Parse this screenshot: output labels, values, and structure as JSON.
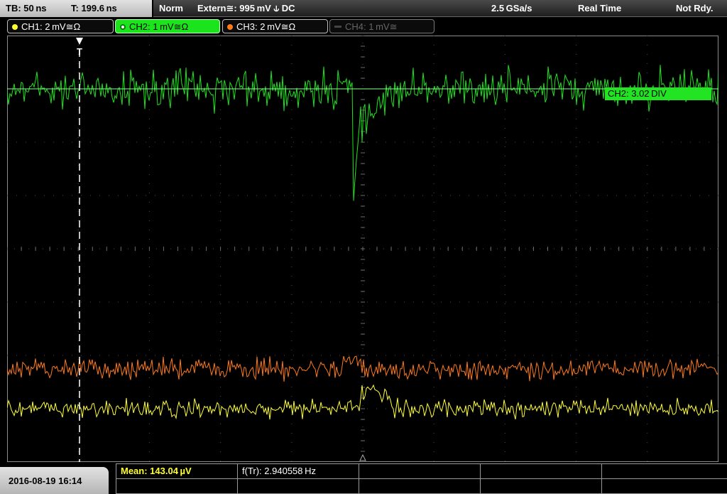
{
  "header": {
    "timebase": "TB: 50 ns",
    "trigger_time": "T: 199.6 ns",
    "trigger_mode": "Norm",
    "trigger_source": "Extern≅: 995 mV ⫝ DC",
    "sample_rate": "2.5 GSa/s",
    "acquisition_mode": "Real Time",
    "status": "Not Rdy."
  },
  "channels": [
    {
      "id": "ch1",
      "label": "CH1: 2 mV≅Ω",
      "color": "#ffff33",
      "active": true
    },
    {
      "id": "ch2",
      "label": "CH2: 1 mV≅Ω",
      "color": "#1ce41c",
      "active": true
    },
    {
      "id": "ch3",
      "label": "CH3: 2 mV≅Ω",
      "color": "#ff7a1a",
      "active": true
    },
    {
      "id": "ch4",
      "label": "CH4: 1 mV≅",
      "color": "#666666",
      "active": false
    }
  ],
  "ch2_offset_label": "CH2: 3.02 DIV",
  "footer": {
    "datetime": "2016-08-19 16:14",
    "mean": "Mean: 143.04 µV",
    "frequency": "f(Tr): 2.940558 Hz"
  },
  "chart_data": {
    "type": "line",
    "grid": true,
    "divisions": {
      "x": 10,
      "y": 8
    },
    "series": [
      {
        "name": "CH2",
        "color": "#1ce41c",
        "baseline_div": 3.0,
        "feature": "negative spike at center, approx -2.3 div"
      },
      {
        "name": "CH3",
        "color": "#ff7a1a",
        "baseline_div": -2.25,
        "feature": "small positive bump at center"
      },
      {
        "name": "CH1",
        "color": "#ffff33",
        "baseline_div": -3.0,
        "feature": "step up at center"
      }
    ],
    "trigger_marker": "T"
  }
}
